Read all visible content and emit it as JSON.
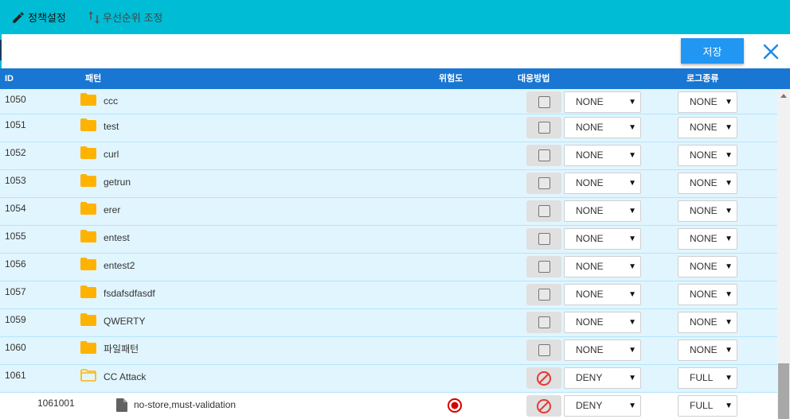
{
  "toolbar": {
    "policy_label": "정책설정",
    "priority_label": "우선순위 조정"
  },
  "actions": {
    "save_label": "저장"
  },
  "table": {
    "headers": {
      "id": "ID",
      "pattern": "패턴",
      "risk": "위험도",
      "response": "대응방법",
      "log_type": "로그종류"
    },
    "rows": [
      {
        "id": "1050",
        "name": "ccc",
        "type": "folder",
        "action": "NONE",
        "log": "NONE",
        "checkbox": true
      },
      {
        "id": "1051",
        "name": "test",
        "type": "folder",
        "action": "NONE",
        "log": "NONE",
        "checkbox": true
      },
      {
        "id": "1052",
        "name": "curl",
        "type": "folder",
        "action": "NONE",
        "log": "NONE",
        "checkbox": true
      },
      {
        "id": "1053",
        "name": "getrun",
        "type": "folder",
        "action": "NONE",
        "log": "NONE",
        "checkbox": true
      },
      {
        "id": "1054",
        "name": "erer",
        "type": "folder",
        "action": "NONE",
        "log": "NONE",
        "checkbox": true
      },
      {
        "id": "1055",
        "name": "entest",
        "type": "folder",
        "action": "NONE",
        "log": "NONE",
        "checkbox": true
      },
      {
        "id": "1056",
        "name": "entest2",
        "type": "folder",
        "action": "NONE",
        "log": "NONE",
        "checkbox": true
      },
      {
        "id": "1057",
        "name": "fsdafsdfasdf",
        "type": "folder",
        "action": "NONE",
        "log": "NONE",
        "checkbox": true
      },
      {
        "id": "1059",
        "name": "QWERTY",
        "type": "folder",
        "action": "NONE",
        "log": "NONE",
        "checkbox": true
      },
      {
        "id": "1060",
        "name": "파일패턴",
        "type": "folder",
        "action": "NONE",
        "log": "NONE",
        "checkbox": true
      },
      {
        "id": "1061",
        "name": "CC Attack",
        "type": "folder-open",
        "action": "DENY",
        "log": "FULL",
        "checkbox": false
      },
      {
        "id": "1061001",
        "name": "no-store,must-validation",
        "type": "file",
        "action": "DENY",
        "log": "FULL",
        "checkbox": false,
        "risk": "high"
      }
    ]
  },
  "colors": {
    "toolbar": "#00bcd4",
    "header": "#1976d2",
    "save_button": "#2196f3",
    "folder_row": "#e1f5fe",
    "folder_icon": "#ffb300",
    "deny_icon": "#e53935",
    "risk_icon": "#d50000"
  },
  "icons": {
    "policy": "pencil-icon",
    "priority": "sort-arrows-icon",
    "close": "close-icon",
    "folder": "folder-icon",
    "folder_open": "folder-outline-icon",
    "file": "file-icon",
    "deny": "block-icon",
    "risk": "radio-risk-icon"
  }
}
